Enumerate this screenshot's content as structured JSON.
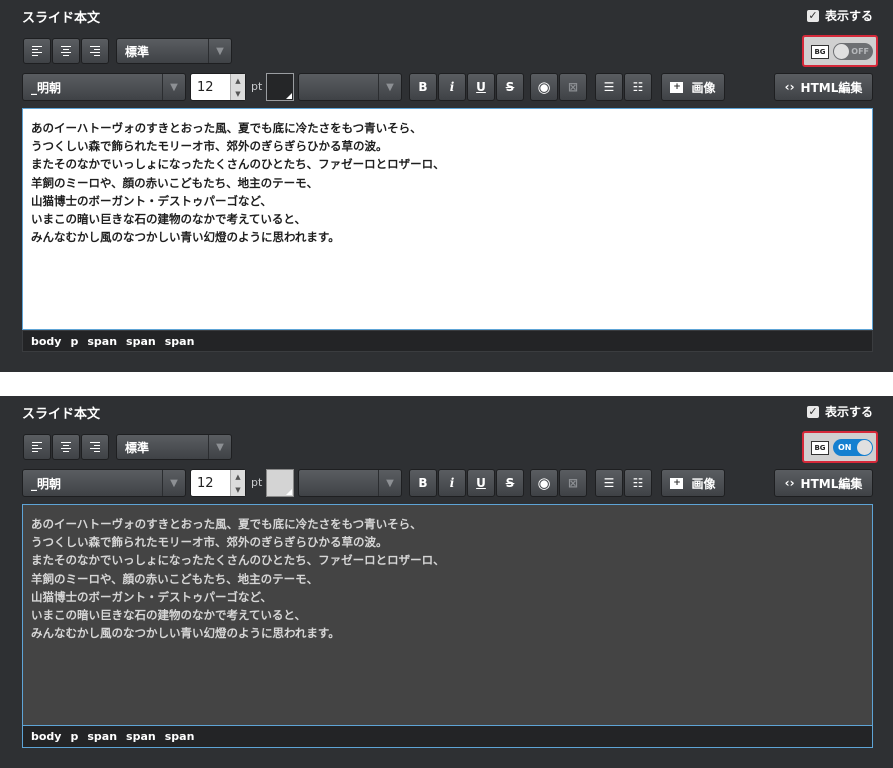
{
  "panels": [
    {
      "title": "スライド本文",
      "show_label": "表示する",
      "style_select": "標準",
      "font_select": "_明朝",
      "font_size": "12",
      "size_unit": "pt",
      "bg_label": "BG",
      "bg_state": "OFF",
      "image_label": "画像",
      "html_label": "HTML編集",
      "text_color": "#252628",
      "content_lines": [
        "あのイーハトーヴォのすきとおった風、夏でも底に冷たさをもつ青いそら、",
        "うつくしい森で飾られたモリーオ市、郊外のぎらぎらひかる草の波。",
        "またそのなかでいっしょになったたくさんのひとたち、ファゼーロとロザーロ、",
        "羊飼のミーロや、顔の赤いこどもたち、地主のテーモ、",
        "山猫博士のボーガント・デストゥパーゴなど、",
        "いまこの暗い巨きな石の建物のなかで考えていると、",
        "みんなむかし風のなつかしい青い幻燈のように思われます。"
      ],
      "path": [
        "body",
        "p",
        "span",
        "span",
        "span"
      ]
    },
    {
      "title": "スライド本文",
      "show_label": "表示する",
      "style_select": "標準",
      "font_select": "_明朝",
      "font_size": "12",
      "size_unit": "pt",
      "bg_label": "BG",
      "bg_state": "ON",
      "image_label": "画像",
      "html_label": "HTML編集",
      "text_color": "#d4d4d4",
      "content_lines": [
        "あのイーハトーヴォのすきとおった風、夏でも底に冷たさをもつ青いそら、",
        "うつくしい森で飾られたモリーオ市、郊外のぎらぎらひかる草の波。",
        "またそのなかでいっしょになったたくさんのひとたち、ファゼーロとロザーロ、",
        "羊飼のミーロや、顔の赤いこどもたち、地主のテーモ、",
        "山猫博士のボーガント・デストゥパーゴなど、",
        "いまこの暗い巨きな石の建物のなかで考えていると、",
        "みんなむかし風のなつかしい青い幻燈のように思われます。"
      ],
      "path": [
        "body",
        "p",
        "span",
        "span",
        "span"
      ]
    }
  ],
  "toolbar": {
    "bold": "B",
    "italic": "i",
    "underline": "U",
    "strike": "S"
  },
  "colors": {
    "panel_bg": "#2e3033",
    "accent_red": "#d5293a",
    "toggle_on": "#1580d0",
    "editor_border": "#5ea4d6"
  }
}
